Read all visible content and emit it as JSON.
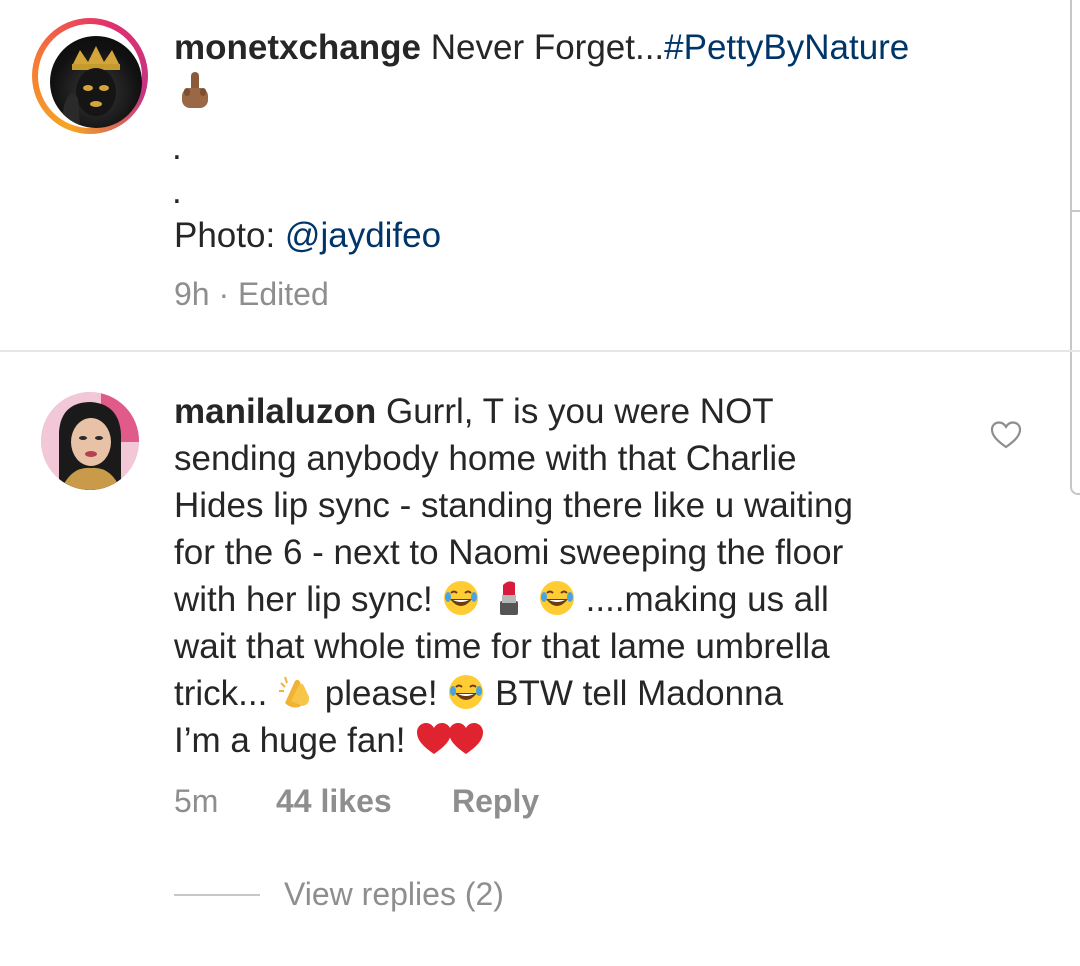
{
  "post": {
    "username": "monetxchange",
    "caption_text": "Never Forget...",
    "hashtag": "#PettyByNature",
    "emoji_line": "middle-finger-icon",
    "dot1": ".",
    "dot2": ".",
    "photo_label": "Photo: ",
    "photo_credit": "@jaydifeo",
    "time": "9h",
    "separator": " · ",
    "edited": "Edited"
  },
  "comment": {
    "username": "manilaluzon",
    "line1": "Gurrl, T is you were NOT",
    "line2": "sending anybody home with that Charlie",
    "line3": "Hides lip sync - standing there like u waiting",
    "line4": "for the 6 - next to Naomi sweeping the floor",
    "line5a": "with her lip sync!",
    "line5b": "....making us all",
    "line6": "wait that whole time for that lame umbrella",
    "line7a": "trick...",
    "line7b": "please!",
    "line7c": "BTW tell Madonna",
    "line8": "I’m a huge fan!",
    "time": "5m",
    "likes": "44 likes",
    "reply": "Reply",
    "view_replies": "View replies (2)"
  },
  "colors": {
    "link": "#003569",
    "meta": "#8e8e8e",
    "text": "#262626"
  }
}
